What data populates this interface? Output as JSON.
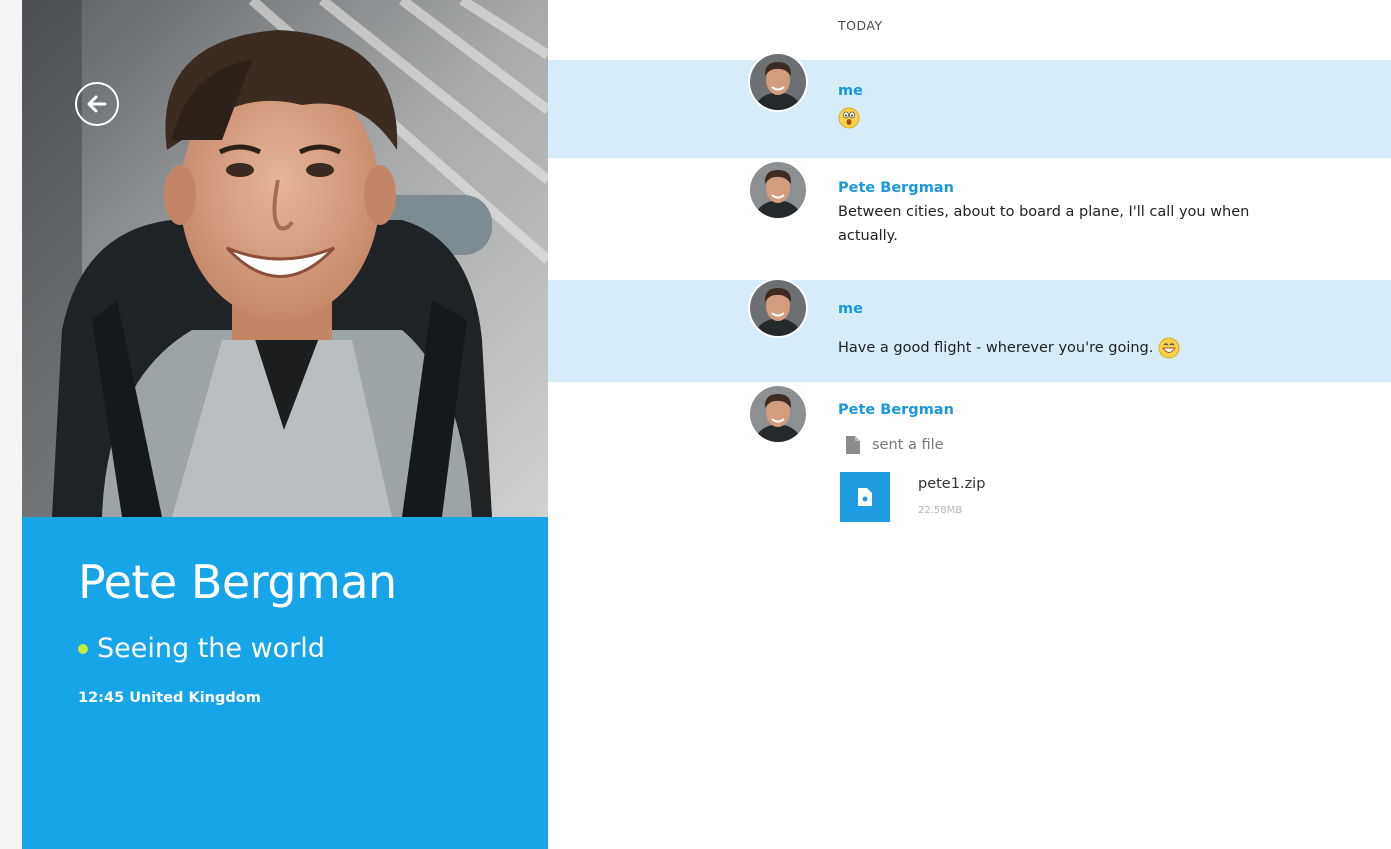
{
  "contact": {
    "name": "Pete Bergman",
    "mood": "Seeing the world",
    "local_time": "12:45 United Kingdom",
    "status_color": "#c6eb3c"
  },
  "conversation": {
    "date_label": "TODAY",
    "messages": [
      {
        "sender": "me",
        "text": "",
        "emoji": "surprised-emoji",
        "self": true
      },
      {
        "sender": "Pete Bergman",
        "text_line1": "Between cities, about to board a plane, I'll call you when",
        "text_line2": "actually.",
        "self": false
      },
      {
        "sender": "me",
        "text": "Have a good flight - wherever you're going.",
        "emoji": "laughing-emoji",
        "self": true
      },
      {
        "sender": "Pete Bergman",
        "action": "sent a file",
        "file": {
          "name": "pete1.zip",
          "size": "22.58MB"
        },
        "self": false
      }
    ]
  },
  "colors": {
    "accent_blue": "#17a5e9",
    "self_message_bg": "#d6ecf9",
    "sender_blue": "#1b98dc"
  },
  "icons": [
    "back-arrow-icon",
    "file-document-icon",
    "zip-file-icon",
    "surprised-emoji",
    "laughing-emoji"
  ]
}
